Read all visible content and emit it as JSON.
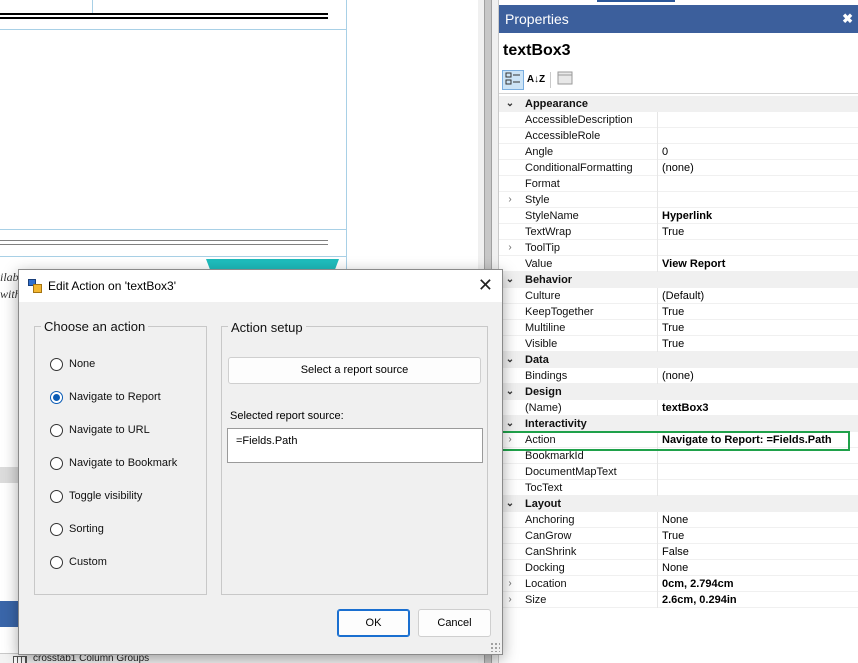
{
  "designer": {
    "fragment_line1": "ilab",
    "fragment_line2": "with",
    "groups_row_text": "crosstab1 Column Groups"
  },
  "properties": {
    "header_title": "Properties",
    "close_glyph": "✖",
    "object_name": "textBox3",
    "toolbar": {
      "categorized_icon": "categorized-icon",
      "alpha_label": "A↓Z",
      "pages_icon": "property-pages-icon"
    },
    "rows": [
      {
        "type": "category",
        "name": "Appearance",
        "expander": "⌄"
      },
      {
        "name": "AccessibleDescription",
        "value": ""
      },
      {
        "name": "AccessibleRole",
        "value": ""
      },
      {
        "name": "Angle",
        "value": "0"
      },
      {
        "name": "ConditionalFormatting",
        "value": "(none)"
      },
      {
        "name": "Format",
        "value": ""
      },
      {
        "name": "Style",
        "value": "",
        "expander": "›"
      },
      {
        "name": "StyleName",
        "value": "Hyperlink",
        "bold": true
      },
      {
        "name": "TextWrap",
        "value": "True"
      },
      {
        "name": "ToolTip",
        "value": "",
        "expander": "›"
      },
      {
        "name": "Value",
        "value": "View Report",
        "bold": true
      },
      {
        "type": "category",
        "name": "Behavior",
        "expander": "⌄"
      },
      {
        "name": "Culture",
        "value": "(Default)"
      },
      {
        "name": "KeepTogether",
        "value": "True"
      },
      {
        "name": "Multiline",
        "value": "True"
      },
      {
        "name": "Visible",
        "value": "True"
      },
      {
        "type": "category",
        "name": "Data",
        "expander": "⌄"
      },
      {
        "name": "Bindings",
        "value": "(none)"
      },
      {
        "type": "category",
        "name": "Design",
        "expander": "⌄"
      },
      {
        "name": "(Name)",
        "value": "textBox3",
        "bold": true
      },
      {
        "type": "category",
        "name": "Interactivity",
        "expander": "⌄"
      },
      {
        "name": "Action",
        "value": "Navigate to Report: =Fields.Path",
        "bold": true,
        "expander": "›"
      },
      {
        "name": "BookmarkId",
        "value": ""
      },
      {
        "name": "DocumentMapText",
        "value": ""
      },
      {
        "name": "TocText",
        "value": ""
      },
      {
        "type": "category",
        "name": "Layout",
        "expander": "⌄"
      },
      {
        "name": "Anchoring",
        "value": "None"
      },
      {
        "name": "CanGrow",
        "value": "True"
      },
      {
        "name": "CanShrink",
        "value": "False"
      },
      {
        "name": "Docking",
        "value": "None"
      },
      {
        "name": "Location",
        "value": "0cm, 2.794cm",
        "bold": true,
        "expander": "›"
      },
      {
        "name": "Size",
        "value": "2.6cm, 0.294in",
        "bold": true,
        "expander": "›"
      }
    ]
  },
  "dialog": {
    "title": "Edit Action on 'textBox3'",
    "close_glyph": "✕",
    "choose_title": "Choose an action",
    "options": [
      {
        "label": "None",
        "checked": false
      },
      {
        "label": "Navigate to Report",
        "checked": true
      },
      {
        "label": "Navigate to URL",
        "checked": false
      },
      {
        "label": "Navigate to Bookmark",
        "checked": false
      },
      {
        "label": "Toggle visibility",
        "checked": false
      },
      {
        "label": "Sorting",
        "checked": false
      },
      {
        "label": "Custom",
        "checked": false
      }
    ],
    "setup_title": "Action setup",
    "select_source_label": "Select a report source",
    "selected_source_label": "Selected report source:",
    "selected_source_value": "=Fields.Path",
    "ok_label": "OK",
    "cancel_label": "Cancel"
  },
  "colors": {
    "panel_header": "#3c5f9c",
    "highlight": "#1fa14a",
    "radio_accent": "#0a5bb5",
    "teal_shape": "#1fbdbd"
  }
}
